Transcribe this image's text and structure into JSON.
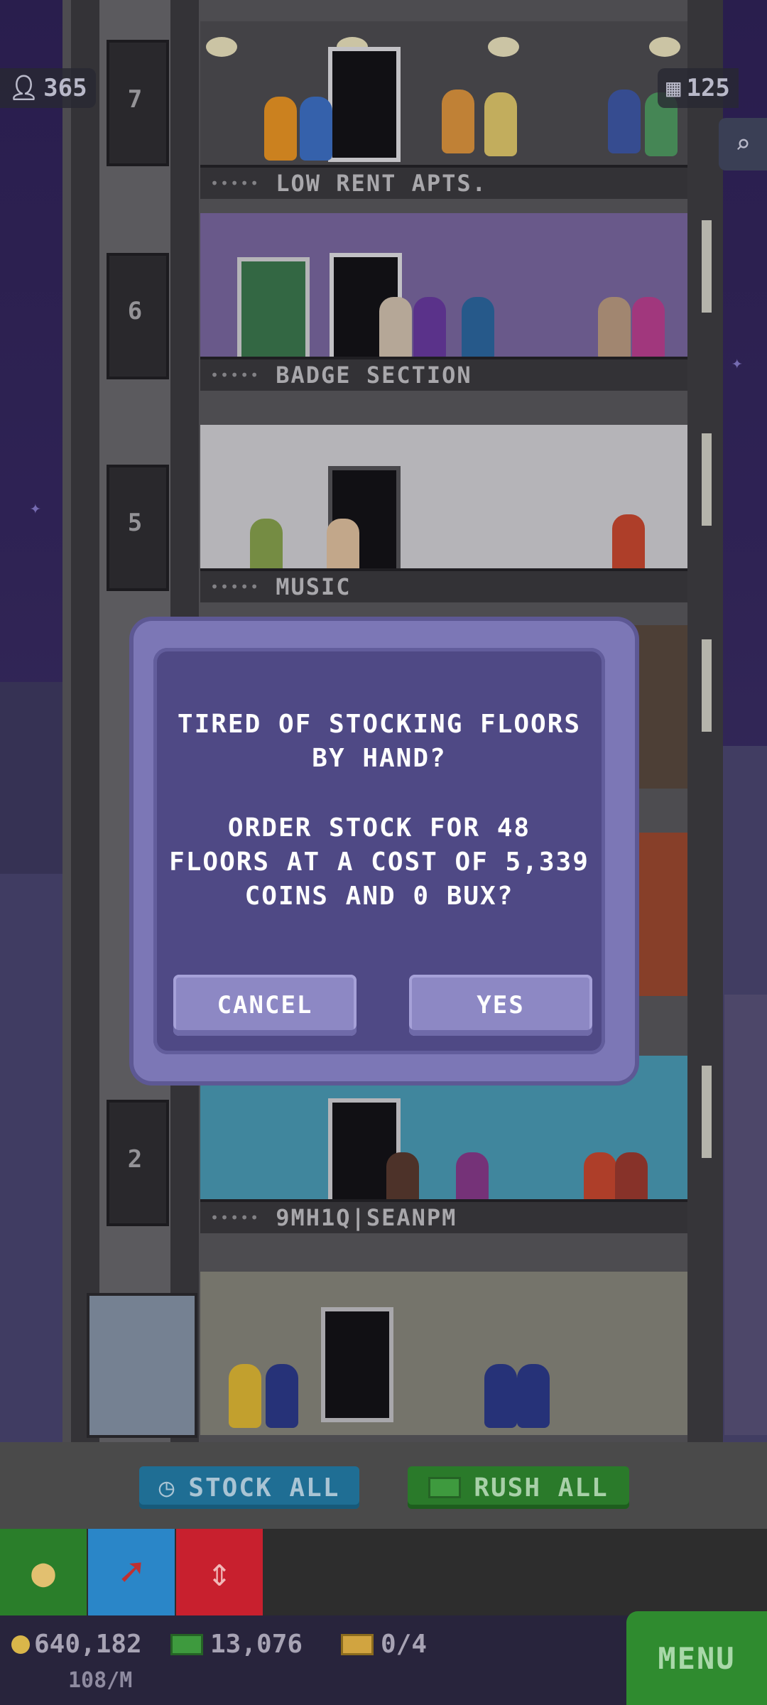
{
  "counters": {
    "population": "365",
    "floors": "125"
  },
  "floors": [
    {
      "number": "7",
      "name": "LOW RENT APTS.",
      "dots": "•••••"
    },
    {
      "number": "6",
      "name": "BADGE SECTION",
      "dots": "•••••"
    },
    {
      "number": "5",
      "name": "MUSIC",
      "dots": "•••••"
    },
    {
      "number": "2",
      "name": "9MH1Q|SEANPM",
      "dots": "•••••"
    }
  ],
  "dialog": {
    "line1": "TIRED OF STOCKING FLOORS",
    "line2": "BY HAND?",
    "line3": "ORDER STOCK FOR 48",
    "line4": "FLOORS AT A COST OF 5,339",
    "line5": "COINS AND 0 BUX?",
    "cancel_label": "CANCEL",
    "yes_label": "YES"
  },
  "actions": {
    "stock_all": "STOCK ALL",
    "rush_all": "RUSH ALL"
  },
  "status": {
    "coins": "640,182",
    "coins_rate": "108/M",
    "bux": "13,076",
    "tickets": "0/4",
    "menu_label": "MENU"
  },
  "colors": {
    "dialog_bg": "#4f4985",
    "dialog_border": "#7c77b6",
    "button": "#8d88c4",
    "stock_all": "#1f6e94",
    "rush_all": "#2a7a2a",
    "menu": "#2f8b2f"
  },
  "icons": [
    "person-icon",
    "building-icon",
    "search-icon",
    "clock-icon",
    "bux-icon",
    "coins-icon",
    "pin-icon",
    "elevator-arrows-icon",
    "coin-icon",
    "ticket-icon"
  ]
}
